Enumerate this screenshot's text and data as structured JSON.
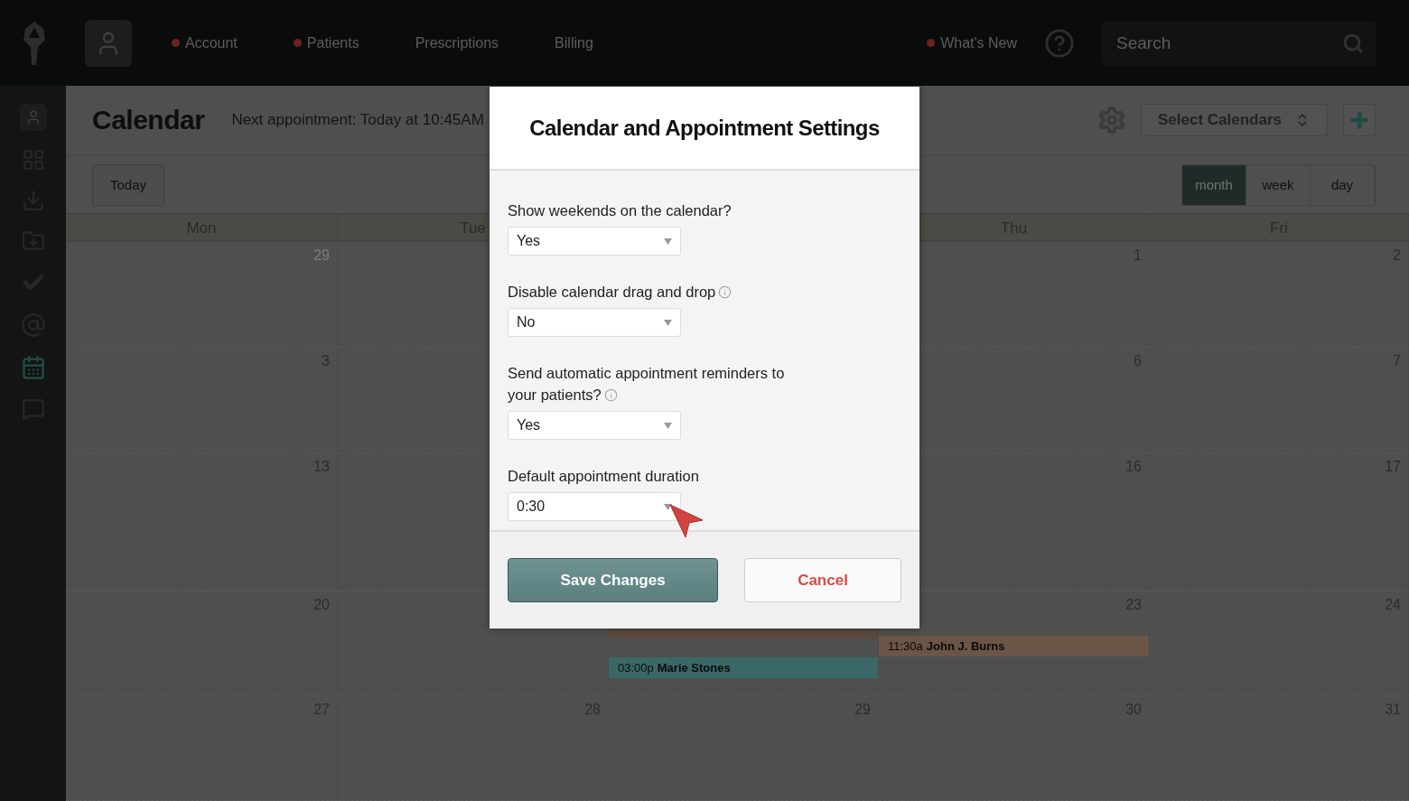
{
  "topbar": {
    "nav": [
      {
        "label": "Account",
        "dot": true
      },
      {
        "label": "Patients",
        "dot": true
      },
      {
        "label": "Prescriptions",
        "dot": false
      },
      {
        "label": "Billing",
        "dot": false
      }
    ],
    "whats_new": {
      "label": "What's New",
      "dot": true
    },
    "search": {
      "placeholder": "Search"
    }
  },
  "sidebar": {
    "items": [
      {
        "kind": "grid",
        "selected": false
      },
      {
        "kind": "download",
        "selected": false
      },
      {
        "kind": "folder",
        "selected": false
      },
      {
        "kind": "check",
        "selected": false
      },
      {
        "kind": "at",
        "selected": false
      },
      {
        "kind": "calendar",
        "selected": true
      },
      {
        "kind": "chat",
        "selected": false
      }
    ]
  },
  "header": {
    "title": "Calendar",
    "next_appointment": "Next appointment: Today at 10:45AM",
    "select_calendars": "Select Calendars"
  },
  "toolbar": {
    "today": "Today",
    "views": [
      {
        "label": "month",
        "selected": true
      },
      {
        "label": "week",
        "selected": false
      },
      {
        "label": "day",
        "selected": false
      }
    ]
  },
  "calendar": {
    "weekdays": {
      "mon": "Mon",
      "tue": "Tue",
      "thu": "Thu",
      "fri": "Fri"
    },
    "weeks": [
      {
        "mon": {
          "day": "29",
          "other_month": true
        },
        "thu": {
          "day": "1",
          "other_month": false
        },
        "fri": {
          "day": "2",
          "other_month": false
        }
      },
      {
        "mon": {
          "day": "3",
          "other_month": false
        },
        "thu": {
          "day": "6",
          "other_month": false
        },
        "fri": {
          "day": "7",
          "other_month": false
        }
      },
      {
        "mon": {
          "day": "13",
          "other_month": false
        },
        "thu": {
          "day": "16",
          "other_month": false
        },
        "fri": {
          "day": "17",
          "other_month": false
        }
      },
      {
        "mon": {
          "day": "20",
          "other_month": false
        },
        "wed": {
          "events": [
            {
              "color": "#5a4a40"
            },
            {
              "time": "03:00p",
              "name": "Marie Stones",
              "color": "#3a6866"
            }
          ]
        },
        "thu": {
          "day": "23",
          "other_month": false,
          "events": [
            {
              "time": "11:30a",
              "name": "John J. Burns",
              "color": "#6a5546"
            }
          ]
        },
        "fri": {
          "day": "24",
          "other_month": false
        }
      },
      {
        "mon": {
          "day": "27",
          "other_month": false
        },
        "tue": {
          "day": "28",
          "other_month": false
        },
        "wed": {
          "day": "29",
          "other_month": false
        },
        "thu": {
          "day": "30",
          "other_month": false
        },
        "fri": {
          "day": "31",
          "other_month": false
        }
      }
    ]
  },
  "modal": {
    "title": "Calendar and Appointment Settings",
    "fields": [
      {
        "label": "Show weekends on the calendar?",
        "info": false,
        "value": "Yes"
      },
      {
        "label": "Disable calendar drag and drop",
        "info": true,
        "value": "No"
      },
      {
        "label": "Send automatic appointment reminders to your patients?",
        "info": true,
        "value": "Yes"
      },
      {
        "label": "Default appointment duration",
        "info": false,
        "value": "0:30"
      }
    ],
    "save": "Save Changes",
    "cancel": "Cancel"
  }
}
